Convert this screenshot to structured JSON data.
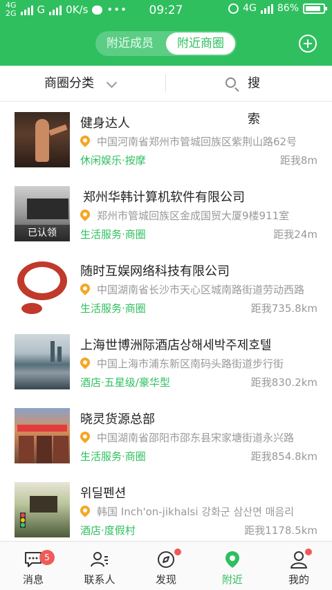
{
  "status_bar": {
    "net_top": "4G",
    "net_bottom": "2G",
    "carrier": "G",
    "speed": "0K/s",
    "time": "09:27",
    "net_right": "4G",
    "battery_percent": "86%",
    "battery_level": 0.86
  },
  "header": {
    "tabs": [
      {
        "label": "附近成员",
        "active": false
      },
      {
        "label": "附近商圈",
        "active": true
      }
    ],
    "add_icon": "plus-circle-icon"
  },
  "filter_bar": {
    "category_label": "商圈分类",
    "search_label": "搜索"
  },
  "items": [
    {
      "title": "健身达人",
      "address": "中国河南省郑州市管城回族区紫荆山路62号",
      "category": "休闲娱乐·按摩",
      "distance": "距我8m",
      "badge": ""
    },
    {
      "title": "郑州华韩计算机软件有限公司",
      "address": "郑州市管城回族区金成国贸大厦9楼911室",
      "category": "生活服务·商圈",
      "distance": "距我24m",
      "badge": "已认领"
    },
    {
      "title": "随时互娱网络科技有限公司",
      "address": "中国湖南省长沙市天心区城南路街道劳动西路",
      "category": "生活服务·商圈",
      "distance": "距我735.8km",
      "badge": ""
    },
    {
      "title": "上海世博洲际酒店상해세박주제호텔",
      "address": "中国上海市浦东新区南码头路街道步行街",
      "category": "酒店·五星级/豪华型",
      "distance": "距我830.2km",
      "badge": ""
    },
    {
      "title": "晓灵货源总部",
      "address": "中国湖南省邵阳市邵东县宋家塘街道永兴路",
      "category": "生活服务·商圈",
      "distance": "距我854.8km",
      "badge": ""
    },
    {
      "title": "위딜펜션",
      "address": "韩国 Inch'on-jikhalsi 강화군 삼산면 매음리",
      "category": "酒店·度假村",
      "distance": "距我1178.5km",
      "badge": ""
    }
  ],
  "tabbar": {
    "tabs": [
      {
        "label": "消息",
        "icon": "message-icon",
        "count": "5",
        "active": false
      },
      {
        "label": "联系人",
        "icon": "contacts-icon",
        "count": "",
        "active": false
      },
      {
        "label": "发现",
        "icon": "compass-icon",
        "count": "",
        "active": false
      },
      {
        "label": "附近",
        "icon": "location-pin-icon",
        "count": "",
        "active": true
      },
      {
        "label": "我的",
        "icon": "profile-icon",
        "count": "",
        "active": false
      }
    ]
  },
  "colors": {
    "primary": "#2fbf5f",
    "accent_orange": "#f5a623",
    "badge_red": "#f05a5a"
  }
}
